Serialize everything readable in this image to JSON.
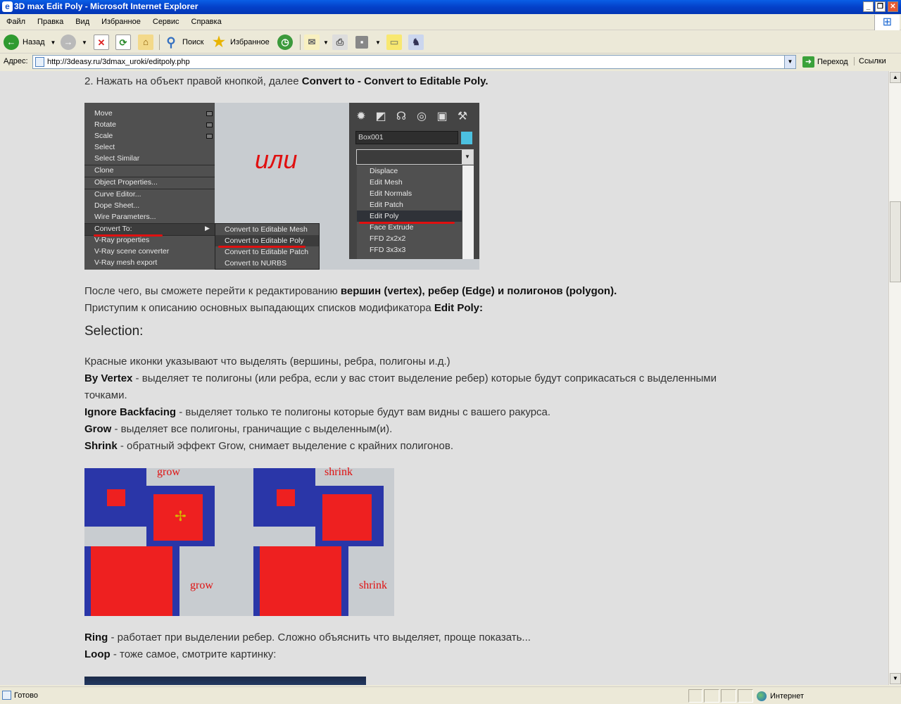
{
  "window": {
    "title": "3D max Edit Poly - Microsoft Internet Explorer"
  },
  "menu": [
    "Файл",
    "Правка",
    "Вид",
    "Избранное",
    "Сервис",
    "Справка"
  ],
  "toolbar": {
    "back": "Назад",
    "search": "Поиск",
    "favorites": "Избранное"
  },
  "address": {
    "label": "Адрес:",
    "url": "http://3deasy.ru/3dmax_uroki/editpoly.php",
    "go": "Переход",
    "links": "Ссылки"
  },
  "status": {
    "text": "Готово",
    "zone": "Интернет"
  },
  "content": {
    "step2_prefix": "2. Нажать на объект правой кнопкой, далее ",
    "step2_bold": "Convert to - Convert to Editable Poly.",
    "shot1": {
      "ctx_items": [
        "Move",
        "Rotate",
        "Scale",
        "Select",
        "Select Similar",
        "Clone",
        "Object Properties...",
        "Curve Editor...",
        "Dope Sheet...",
        "Wire Parameters...",
        "Convert To:",
        "V-Ray properties",
        "V-Ray scene converter",
        "V-Ray mesh export"
      ],
      "sub_items": [
        "Convert to Editable Mesh",
        "Convert to Editable Poly",
        "Convert to Editable Patch",
        "Convert to NURBS"
      ],
      "or_text": "или",
      "object_name": "Box001",
      "modifiers": [
        "Displace",
        "Edit Mesh",
        "Edit Normals",
        "Edit Patch",
        "Edit Poly",
        "Face Extrude",
        "FFD 2x2x2",
        "FFD 3x3x3"
      ]
    },
    "after1_prefix": "После чего, вы сможете перейти к редактированию ",
    "after1_bold": "вершин (vertex), ребер (Edge) и полигонов (polygon).",
    "after2_prefix": "Приступим к описанию основных выпадающих списков модификатора ",
    "after2_bold": "Edit Poly:",
    "selection_heading": "Selection:",
    "red_icons": "Красные иконки указывают что выделять (вершины, ребра, полигоны и.д.)",
    "by_vertex_term": "By Vertex",
    "by_vertex_desc": " - выделяет те полигоны (или ребра, если у вас стоит выделение ребер) которые будут соприкасаться с выделенными",
    "by_vertex_cont": "точками.",
    "ignore_term": "Ignore Backfacing",
    "ignore_desc": " - выделяет только те полигоны которые будут вам видны с вашего ракурса.",
    "grow_term": "Grow",
    "grow_desc": " - выделяет все полигоны, граничащие с выделенным(и).",
    "shrink_term": "Shrink",
    "shrink_desc": " - обратный эффект Grow, снимает выделение с крайних полигонов.",
    "shot2": {
      "grow": "grow",
      "shrink": "shrink"
    },
    "ring_term": "Ring",
    "ring_desc": " - работает при выделении ребер. Сложно объяснить что выделяет, проще показать...",
    "loop_term": "Loop",
    "loop_desc": " - тоже самое, смотрите картинку:"
  }
}
